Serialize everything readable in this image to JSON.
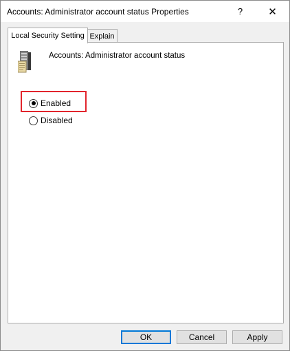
{
  "window": {
    "title": "Accounts: Administrator account status Properties",
    "help_label": "?",
    "close_label": "✕"
  },
  "tabs": [
    {
      "label": "Local Security Setting",
      "active": true
    },
    {
      "label": "Explain",
      "active": false
    }
  ],
  "policy": {
    "icon": "server-policy-icon",
    "name": "Accounts: Administrator account status"
  },
  "options": {
    "enabled_label": "Enabled",
    "disabled_label": "Disabled",
    "selected": "Enabled"
  },
  "buttons": {
    "ok_label": "OK",
    "cancel_label": "Cancel",
    "apply_label": "Apply"
  },
  "colors": {
    "highlight": "#e2242c",
    "default_button_border": "#0078d7"
  }
}
